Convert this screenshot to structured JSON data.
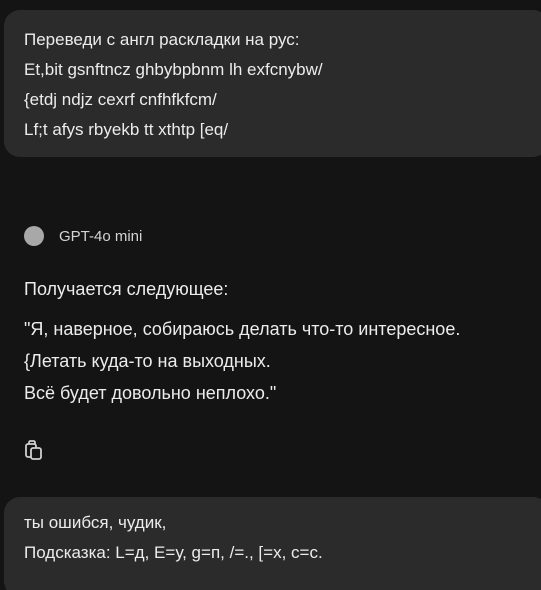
{
  "user_message_1": {
    "lines": [
      "Переведи с англ раскладки на рус:",
      "Et,bit gsnftncz ghbybpbnm lh exfcnybw/",
      "{etdj ndjz cexrf cnfhfkfcm/",
      "Lf;t afys rbyekb tt xthtp [eq/"
    ]
  },
  "assistant": {
    "model_name": "GPT-4o mini",
    "intro": "Получается следующее:",
    "lines": [
      "\"Я, наверное, собираюсь делать что-то интересное.",
      "{Летать куда-то на выходных.",
      "Всё будет довольно неплохо.\""
    ],
    "copy_icon": "copy-icon"
  },
  "user_message_2": {
    "lines": [
      "ты ошибся, чудик,",
      "Подсказка: L=д, E=у, g=п, /=., [=х, c=с."
    ]
  }
}
